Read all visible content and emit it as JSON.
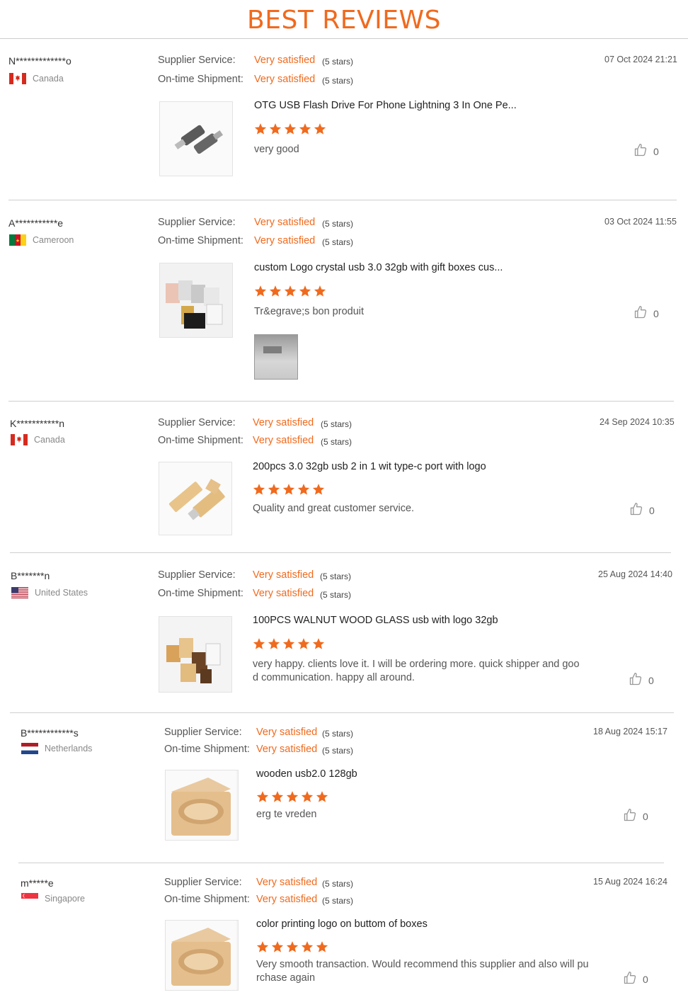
{
  "page_title": "BEST REVIEWS",
  "labels": {
    "supplier": "Supplier Service:",
    "shipment": "On-time Shipment:"
  },
  "colors": {
    "accent": "#f06a1e"
  },
  "reviews": [
    {
      "name": "N*************o",
      "country": "Canada",
      "flag": "canada",
      "date": "07 Oct 2024 21:21",
      "supplier": "Very satisfied",
      "supplier_stars": "(5 stars)",
      "shipment": "Very satisfied",
      "shipment_stars": "(5 stars)",
      "product": "OTG USB Flash Drive For Phone Lightning 3 In One Pe...",
      "rating": 5,
      "comment": "very good",
      "likes": "0"
    },
    {
      "name": "A***********e",
      "country": "Cameroon",
      "flag": "cameroon",
      "date": "03 Oct 2024 11:55",
      "supplier": "Very satisfied",
      "supplier_stars": "(5 stars)",
      "shipment": "Very satisfied",
      "shipment_stars": "(5 stars)",
      "product": "custom Logo crystal usb 3.0 32gb with gift boxes cus...",
      "rating": 5,
      "comment": "Tr&egrave;s bon produit",
      "likes": "0"
    },
    {
      "name": "K***********n",
      "country": "Canada",
      "flag": "canada",
      "date": "24 Sep 2024 10:35",
      "supplier": "Very satisfied",
      "supplier_stars": "(5 stars)",
      "shipment": "Very satisfied",
      "shipment_stars": "(5 stars)",
      "product": "200pcs 3.0 32gb usb 2 in 1 wit type-c port with logo",
      "rating": 5,
      "comment": "Quality and great customer service.",
      "likes": "0"
    },
    {
      "name": "B*******n",
      "country": "United States",
      "flag": "usa",
      "date": "25 Aug 2024 14:40",
      "supplier": "Very satisfied",
      "supplier_stars": "(5 stars)",
      "shipment": "Very satisfied",
      "shipment_stars": "(5 stars)",
      "product": "100PCS WALNUT WOOD GLASS usb with logo 32gb",
      "rating": 5,
      "comment": "very happy.  clients love it. I will be ordering more.   quick shipper and goo d communication.  happy all around.",
      "likes": "0"
    },
    {
      "name": "B************s",
      "country": "Netherlands",
      "flag": "netherlands",
      "date": "18 Aug 2024 15:17",
      "supplier": "Very satisfied",
      "supplier_stars": "(5 stars)",
      "shipment": "Very satisfied",
      "shipment_stars": "(5 stars)",
      "product": "wooden usb2.0 128gb",
      "rating": 5,
      "comment": "erg te vreden",
      "likes": "0"
    },
    {
      "name": "m*****e",
      "country": "Singapore",
      "flag": "singapore",
      "date": "15 Aug 2024 16:24",
      "supplier": "Very satisfied",
      "supplier_stars": "(5 stars)",
      "shipment": "Very satisfied",
      "shipment_stars": "(5 stars)",
      "product": "color printing logo on buttom of boxes",
      "rating": 5,
      "comment": "Very smooth transaction. Would recommend this supplier and also will pu rchase again",
      "likes": "0"
    }
  ]
}
